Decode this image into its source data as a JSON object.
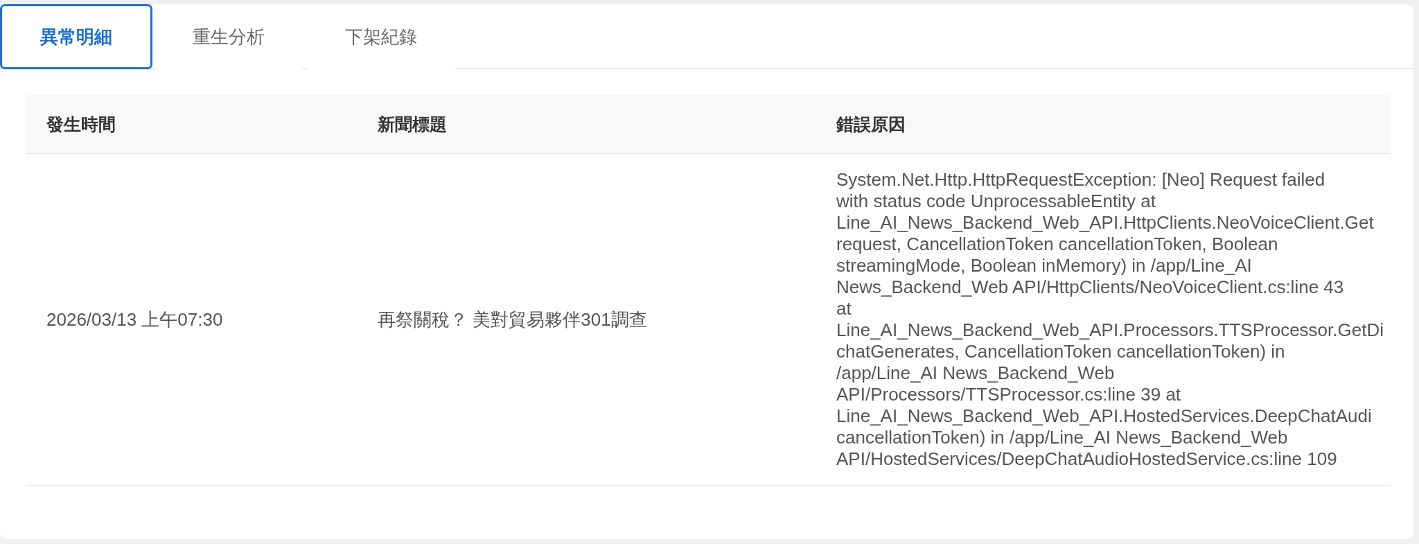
{
  "tabs": [
    {
      "label": "異常明細",
      "selected": true
    },
    {
      "label": "重生分析",
      "selected": false
    },
    {
      "label": "下架紀錄",
      "selected": false
    }
  ],
  "table": {
    "columns": [
      "發生時間",
      "新聞標題",
      "錯誤原因"
    ],
    "rows": [
      {
        "time": "2026/03/13 上午07:30",
        "title": "再祭關稅？ 美對貿易夥伴301調查",
        "error_lines": [
          "System.Net.Http.HttpRequestException: [Neo] Request failed",
          "with status code UnprocessableEntity at",
          "Line_AI_News_Backend_Web_API.HttpClients.NeoVoiceClient.Get",
          "request, CancellationToken cancellationToken, Boolean",
          "streamingMode, Boolean inMemory) in /app/Line_AI",
          "News_Backend_Web API/HttpClients/NeoVoiceClient.cs:line 43",
          "at",
          "Line_AI_News_Backend_Web_API.Processors.TTSProcessor.GetDi",
          "chatGenerates, CancellationToken cancellationToken) in",
          "/app/Line_AI News_Backend_Web",
          "API/Processors/TTSProcessor.cs:line 39 at",
          "Line_AI_News_Backend_Web_API.HostedServices.DeepChatAudi",
          "cancellationToken) in /app/Line_AI News_Backend_Web",
          "API/HostedServices/DeepChatAudioHostedService.cs:line 109"
        ]
      }
    ]
  }
}
